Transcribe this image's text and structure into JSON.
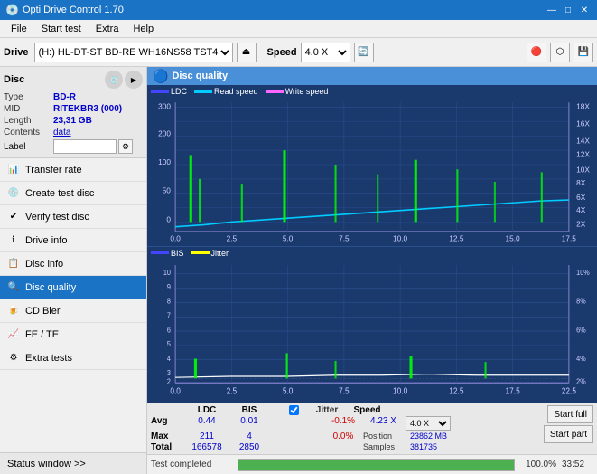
{
  "titleBar": {
    "title": "Opti Drive Control 1.70",
    "minimize": "—",
    "maximize": "□",
    "close": "✕"
  },
  "menuBar": {
    "items": [
      "File",
      "Start test",
      "Extra",
      "Help"
    ]
  },
  "toolbar": {
    "driveLabel": "Drive",
    "driveValue": "(H:) HL-DT-ST BD-RE  WH16NS58 TST4",
    "speedLabel": "Speed",
    "speedValue": "4.0 X"
  },
  "disc": {
    "title": "Disc",
    "typeLabel": "Type",
    "typeValue": "BD-R",
    "midLabel": "MID",
    "midValue": "RITEKBR3 (000)",
    "lengthLabel": "Length",
    "lengthValue": "23,31 GB",
    "contentsLabel": "Contents",
    "contentsValue": "data",
    "labelLabel": "Label",
    "labelValue": ""
  },
  "navItems": [
    {
      "id": "transfer-rate",
      "label": "Transfer rate",
      "icon": "📊"
    },
    {
      "id": "create-test-disc",
      "label": "Create test disc",
      "icon": "💿"
    },
    {
      "id": "verify-test-disc",
      "label": "Verify test disc",
      "icon": "✔"
    },
    {
      "id": "drive-info",
      "label": "Drive info",
      "icon": "ℹ"
    },
    {
      "id": "disc-info",
      "label": "Disc info",
      "icon": "📋"
    },
    {
      "id": "disc-quality",
      "label": "Disc quality",
      "icon": "🔍",
      "active": true
    },
    {
      "id": "cd-bier",
      "label": "CD Bier",
      "icon": "🍺"
    },
    {
      "id": "fe-te",
      "label": "FE / TE",
      "icon": "📈"
    },
    {
      "id": "extra-tests",
      "label": "Extra tests",
      "icon": "⚙"
    }
  ],
  "statusWindow": "Status window >>",
  "discQuality": {
    "title": "Disc quality",
    "legend": {
      "ldc": "LDC",
      "readSpeed": "Read speed",
      "writeSpeed": "Write speed"
    },
    "legend2": {
      "bis": "BIS",
      "jitter": "Jitter"
    }
  },
  "stats": {
    "headers": [
      "",
      "LDC",
      "BIS",
      "",
      "Jitter",
      "Speed",
      ""
    ],
    "avg": {
      "label": "Avg",
      "ldc": "0.44",
      "bis": "0.01",
      "jitter": "-0.1%",
      "speed": "4.23 X",
      "speedSel": "4.0 X"
    },
    "max": {
      "label": "Max",
      "ldc": "211",
      "bis": "4",
      "jitter": "0.0%",
      "positionLabel": "Position",
      "positionVal": "23862 MB"
    },
    "total": {
      "label": "Total",
      "ldc": "166578",
      "bis": "2850",
      "samplesLabel": "Samples",
      "samplesVal": "381735"
    },
    "startFull": "Start full",
    "startPart": "Start part",
    "jitterChecked": true
  },
  "progressBar": {
    "percent": 100,
    "percentText": "100.0%",
    "time": "33:52",
    "statusText": "Test completed"
  },
  "colors": {
    "ldc": "#00ff00",
    "readSpeed": "#00ccff",
    "writeSpeed": "#ff66ff",
    "bis": "#00ff00",
    "jitter": "#ffff00",
    "chartBg": "#1a3a6e",
    "gridLine": "#2a5090",
    "accent": "#1a73c4",
    "progressGreen": "#4caf50"
  }
}
